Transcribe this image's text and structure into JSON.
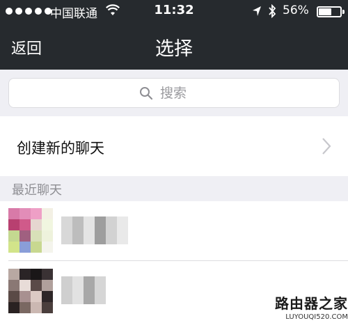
{
  "status_bar": {
    "carrier": "中国联通",
    "time": "11:32",
    "battery_percent": "56%",
    "battery_level": 0.56,
    "icons": [
      "signal-dots-icon",
      "wifi-icon",
      "location-arrow-icon",
      "bluetooth-icon",
      "battery-icon"
    ]
  },
  "nav": {
    "back_label": "返回",
    "title": "选择"
  },
  "search": {
    "placeholder": "搜索",
    "icon": "search-icon"
  },
  "create_chat": {
    "label": "创建新的聊天",
    "icon": "chevron-right-icon"
  },
  "recent_section": {
    "label": "最近聊天"
  },
  "contacts": [
    {
      "avatar": "blurred-avatar",
      "name": ""
    },
    {
      "avatar": "blurred-avatar",
      "name": ""
    }
  ],
  "watermark": {
    "main": "路由器之家",
    "sub": "LUYOUQI520.COM"
  },
  "colors": {
    "nav_background": "#262a2e",
    "page_background": "#efeff4",
    "section_text": "#8e8e93",
    "cell_background": "#ffffff"
  }
}
